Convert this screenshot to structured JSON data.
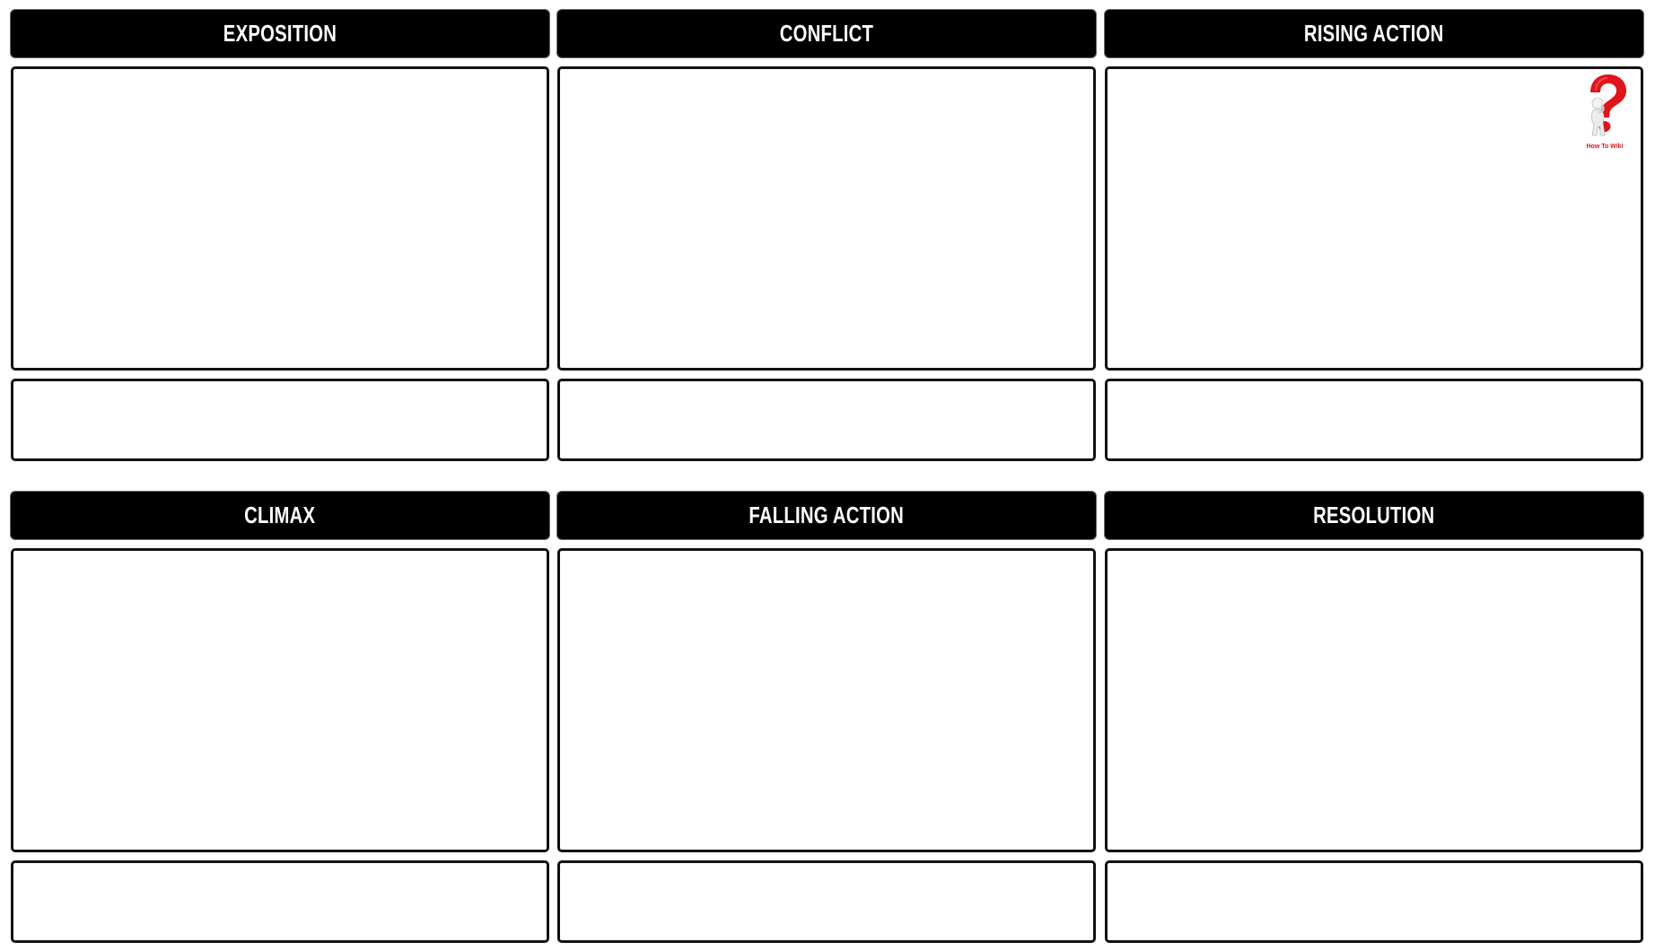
{
  "storyboard": {
    "cells": [
      {
        "title": "EXPOSITION",
        "image_text": "",
        "caption_text": ""
      },
      {
        "title": "CONFLICT",
        "image_text": "",
        "caption_text": ""
      },
      {
        "title": "RISING ACTION",
        "image_text": "",
        "caption_text": ""
      },
      {
        "title": "CLIMAX",
        "image_text": "",
        "caption_text": ""
      },
      {
        "title": "FALLING ACTION",
        "image_text": "",
        "caption_text": ""
      },
      {
        "title": "RESOLUTION",
        "image_text": "",
        "caption_text": ""
      }
    ]
  },
  "watermark": {
    "icon": "question-mark-figure-icon",
    "caption": "How To Wiki",
    "color": "#d9161c"
  },
  "colors": {
    "header_background": "#000000",
    "header_text": "#ffffff",
    "box_border": "#111111",
    "page_background": "#ffffff"
  }
}
